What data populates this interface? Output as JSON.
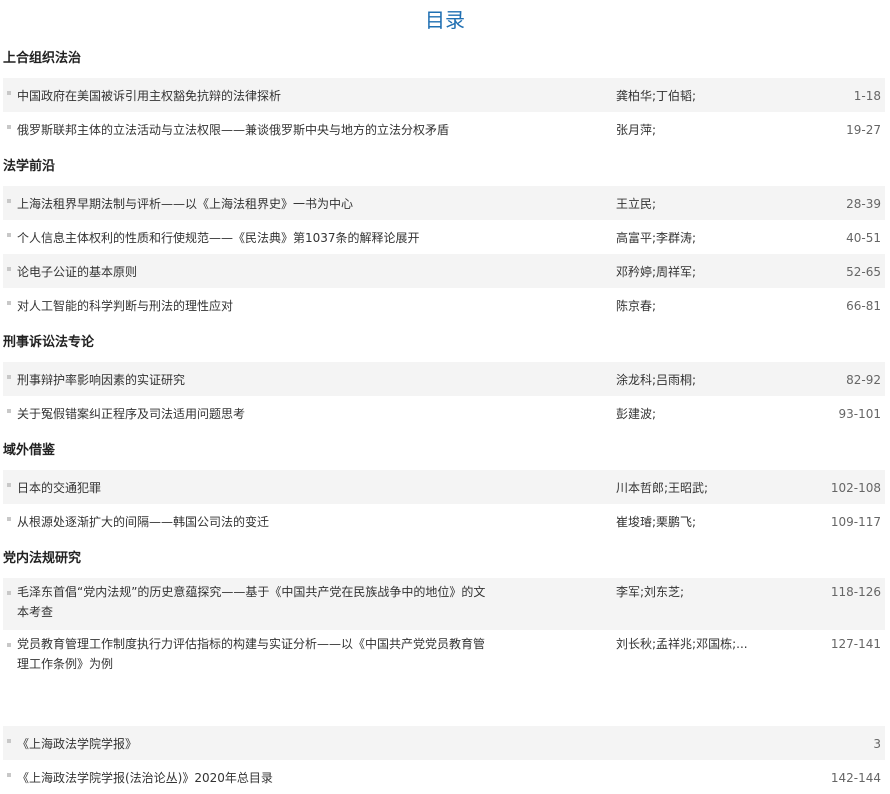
{
  "title": "目录",
  "sections": [
    {
      "heading": "上合组织法治",
      "items": [
        {
          "title": "中国政府在美国被诉引用主权豁免抗辩的法律探析",
          "authors": "龚柏华;丁伯韬;",
          "pages": "1-18"
        },
        {
          "title": "俄罗斯联邦主体的立法活动与立法权限——兼谈俄罗斯中央与地方的立法分权矛盾",
          "authors": "张月萍;",
          "pages": "19-27"
        }
      ]
    },
    {
      "heading": "法学前沿",
      "items": [
        {
          "title": "上海法租界早期法制与评析——以《上海法租界史》一书为中心",
          "authors": "王立民;",
          "pages": "28-39"
        },
        {
          "title": "个人信息主体权利的性质和行使规范——《民法典》第1037条的解释论展开",
          "authors": "高富平;李群涛;",
          "pages": "40-51"
        },
        {
          "title": "论电子公证的基本原则",
          "authors": "邓矜婷;周祥军;",
          "pages": "52-65"
        },
        {
          "title": "对人工智能的科学判断与刑法的理性应对",
          "authors": "陈京春;",
          "pages": "66-81"
        }
      ]
    },
    {
      "heading": "刑事诉讼法专论",
      "items": [
        {
          "title": "刑事辩护率影响因素的实证研究",
          "authors": "涂龙科;吕雨桐;",
          "pages": "82-92"
        },
        {
          "title": "关于冤假错案纠正程序及司法适用问题思考",
          "authors": "彭建波;",
          "pages": "93-101"
        }
      ]
    },
    {
      "heading": "域外借鉴",
      "items": [
        {
          "title": "日本的交通犯罪",
          "authors": "川本哲郎;王昭武;",
          "pages": "102-108"
        },
        {
          "title": "从根源处逐渐扩大的间隔——韩国公司法的变迁",
          "authors": "崔埈璿;栗鹏飞;",
          "pages": "109-117"
        }
      ]
    },
    {
      "heading": "党内法规研究",
      "items": [
        {
          "title": "毛泽东首倡“党内法规”的历史意蕴探究——基于《中国共产党在民族战争中的地位》的文本考查",
          "authors": "李军;刘东芝;",
          "pages": "118-126"
        },
        {
          "title": "党员教育管理工作制度执行力评估指标的构建与实证分析——以《中国共产党党员教育管理工作条例》为例",
          "authors": "刘长秋;孟祥兆;邓国栋;...",
          "pages": "127-141"
        }
      ]
    }
  ],
  "extra_items": [
    {
      "title": "《上海政法学院学报》",
      "authors": "",
      "pages": "3"
    },
    {
      "title": "《上海政法学院学报(法治论丛)》2020年总目录",
      "authors": "",
      "pages": "142-144"
    }
  ]
}
